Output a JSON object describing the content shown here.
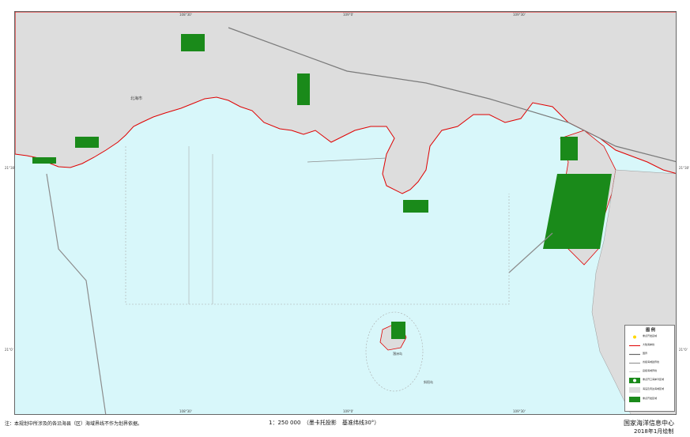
{
  "map": {
    "ticks": {
      "top": [
        "108°30'",
        "109°0'",
        "109°30'"
      ],
      "bottom": [
        "108°30'",
        "109°0'",
        "109°30'"
      ],
      "left": [
        "21°30'",
        "21°0'"
      ],
      "right": [
        "21°30'",
        "21°0'"
      ]
    },
    "place_labels": [
      "北海市",
      "涠洲岛",
      "斜阳岛"
    ],
    "colors": {
      "sea": "#d8f7fa",
      "land": "#dddddd",
      "coastline": "#e00000",
      "protected_area": "#1a8a1a",
      "boundary": "#8c8c8c",
      "road": "#7a7a7a"
    }
  },
  "legend": {
    "title": "图 例",
    "items": [
      {
        "label": "重点开发县城",
        "icon": "yellow-dot-icon"
      },
      {
        "label": "大陆海岸线",
        "icon": "red-line-icon"
      },
      {
        "label": "国界",
        "icon": "gray-line-icon"
      },
      {
        "label": "省级海域勘界线",
        "icon": "dark-line-icon"
      },
      {
        "label": "县级海域界线",
        "icon": "thin-line-icon"
      },
      {
        "label": "重点开口海岸湾区域",
        "icon": "green-circle-icon"
      },
      {
        "label": "海岛及周边海域区域",
        "icon": "gray-box-icon"
      },
      {
        "label": "重点开发区域",
        "icon": "green-box-icon"
      }
    ]
  },
  "footer": {
    "note": "注：本规划中所涉及的各沿海县（区）海域界线不作为划界依据。",
    "scale": "1：250 000　（墨卡托投影　基准纬线30°）",
    "org": "国家海洋信息中心",
    "date": "2018年1月绘制"
  }
}
